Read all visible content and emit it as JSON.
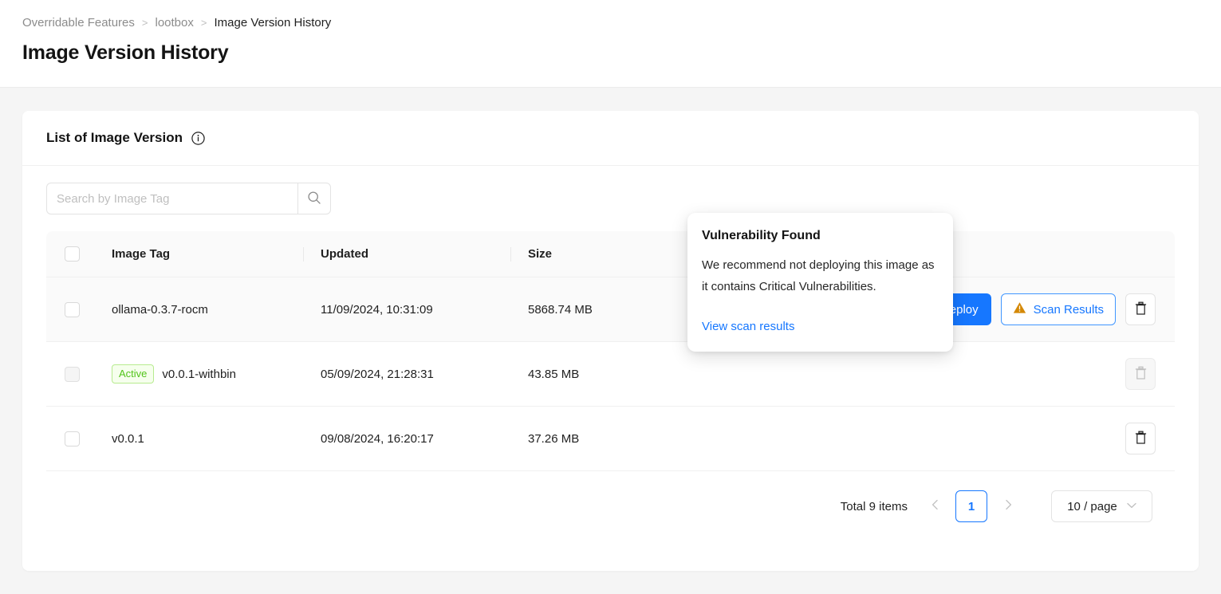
{
  "breadcrumb": {
    "items": [
      {
        "label": "Overridable Features",
        "current": false
      },
      {
        "label": "lootbox",
        "current": false
      },
      {
        "label": "Image Version History",
        "current": true
      }
    ],
    "separator": ">"
  },
  "page": {
    "title": "Image Version History"
  },
  "card": {
    "title": "List of Image Version",
    "info_icon": "info-circle-icon"
  },
  "search": {
    "placeholder": "Search by Image Tag",
    "value": "",
    "button_icon": "search-icon"
  },
  "table": {
    "columns": [
      {
        "key": "select",
        "label": ""
      },
      {
        "key": "image_tag",
        "label": "Image Tag"
      },
      {
        "key": "updated",
        "label": "Updated"
      },
      {
        "key": "size",
        "label": "Size"
      }
    ],
    "rows": [
      {
        "image_tag": "ollama-0.3.7-rocm",
        "updated": "11/09/2024, 10:31:09",
        "size": "5868.74 MB",
        "badge": "",
        "checkbox_disabled": false,
        "deploy_label": "Deploy",
        "scan_label": "Scan Results",
        "scan_icon": "warning-triangle-icon",
        "delete_icon": "trash-icon",
        "delete_disabled": false,
        "hovered": true
      },
      {
        "image_tag": "v0.0.1-withbin",
        "updated": "05/09/2024, 21:28:31",
        "size": "43.85 MB",
        "badge": "Active",
        "checkbox_disabled": true,
        "deploy_label": "",
        "scan_label": "",
        "scan_icon": "",
        "delete_icon": "trash-icon",
        "delete_disabled": true,
        "hovered": false
      },
      {
        "image_tag": "v0.0.1",
        "updated": "09/08/2024, 16:20:17",
        "size": "37.26 MB",
        "badge": "",
        "checkbox_disabled": false,
        "deploy_label": "",
        "scan_label": "",
        "scan_icon": "",
        "delete_icon": "trash-icon",
        "delete_disabled": false,
        "hovered": false
      }
    ]
  },
  "popover": {
    "title": "Vulnerability Found",
    "body": "We recommend not deploying this image as it contains Critical Vulnerabilities.",
    "link": "View scan results"
  },
  "pagination": {
    "total_text": "Total 9 items",
    "prev_icon": "chevron-left-icon",
    "next_icon": "chevron-right-icon",
    "current_page": "1",
    "page_size": "10 / page",
    "page_size_icon": "chevron-down-icon"
  },
  "colors": {
    "accent": "#1677ff",
    "warning": "#d48806",
    "success": "#52c41a",
    "page_bg": "#f5f5f5"
  }
}
